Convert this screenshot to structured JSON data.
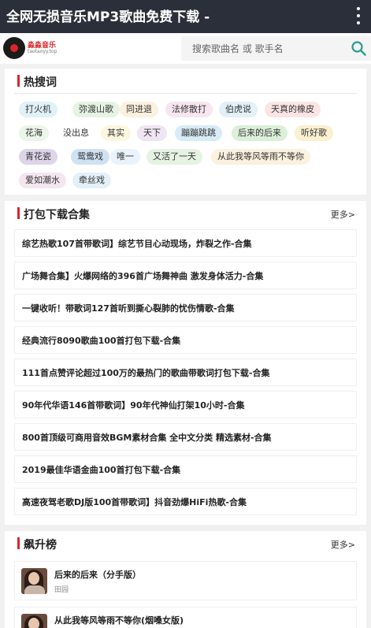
{
  "app": {
    "title": "全网无损音乐MP3歌曲免费下载 -"
  },
  "header": {
    "logo_name": "淼淼音乐",
    "logo_sub": "taotaoyy.top",
    "search_placeholder": "搜索歌曲名 或 歌手名"
  },
  "hot": {
    "title": "热搜词",
    "tags": [
      {
        "label": "打火机",
        "color": "#e0f1f7"
      },
      {
        "label": "弥渡山歌",
        "color": "#e6f3e3"
      },
      {
        "label": "同进退",
        "color": "#fbf1df"
      },
      {
        "label": "法修散打",
        "color": "#f7e6ef"
      },
      {
        "label": "伯虎说",
        "color": "#e3f0f8"
      },
      {
        "label": "天真的橡皮",
        "color": "#fbe4e4"
      },
      {
        "label": "花海",
        "color": "#ecf5ea"
      },
      {
        "label": "没出息",
        "color": "#ffffff"
      },
      {
        "label": "其实",
        "color": "#fdf7e0"
      },
      {
        "label": "天下",
        "color": "#efe5f3"
      },
      {
        "label": "蹦蹦跳跳",
        "color": "#d7ecf6"
      },
      {
        "label": "后来的后来",
        "color": "#dcefd8"
      },
      {
        "label": "听好歌",
        "color": "#fbf0cf"
      },
      {
        "label": "青花瓷",
        "color": "#ddd5ea"
      },
      {
        "label": "鸳鸯戏",
        "color": "#cfe2f3"
      },
      {
        "label": "唯一",
        "color": "#eaf3fb"
      },
      {
        "label": "又活了一天",
        "color": "#e6f3e3"
      },
      {
        "label": "从此我等风等雨不等你",
        "color": "#fbf1df"
      },
      {
        "label": "爱如潮水",
        "color": "#f3e6ef"
      },
      {
        "label": "牵丝戏",
        "color": "#e3f0f8"
      }
    ]
  },
  "packs": {
    "title": "打包下载合集",
    "more": "更多>",
    "items": [
      "综艺热歌107首带歌词】综艺节目心动现场，炸裂之作-合集",
      "广场舞合集】火爆网络的396首广场舞神曲 激发身体活力-合集",
      "一键收听！带歌词127首听到撕心裂肺的忧伤情歌-合集",
      "经典流行8090歌曲100首打包下载-合集",
      "111首点赞评论超过100万的最热门的歌曲带歌词打包下载-合集",
      "90年代华语146首带歌词】90年代神仙打架10小时-合集",
      "800首顶级可商用音效BGM素材合集 全中文分类 精选素材-合集",
      "2019最佳华语金曲100首打包下载-合集",
      "高速夜驾老歌DJ版100首带歌词】抖音劲爆HiFi热歌-合集"
    ]
  },
  "rising": {
    "title": "飙升榜",
    "more": "更多>",
    "songs": [
      {
        "name": "后来的后来（分手版）",
        "singer": "田园"
      },
      {
        "name": "从此我等风等雨不等你(烟嗓女版)",
        "singer": ""
      }
    ]
  },
  "colors": {
    "accent": "#d9252b",
    "titlebar": "#2b2f3a",
    "search_icon": "#2a9d8f"
  }
}
